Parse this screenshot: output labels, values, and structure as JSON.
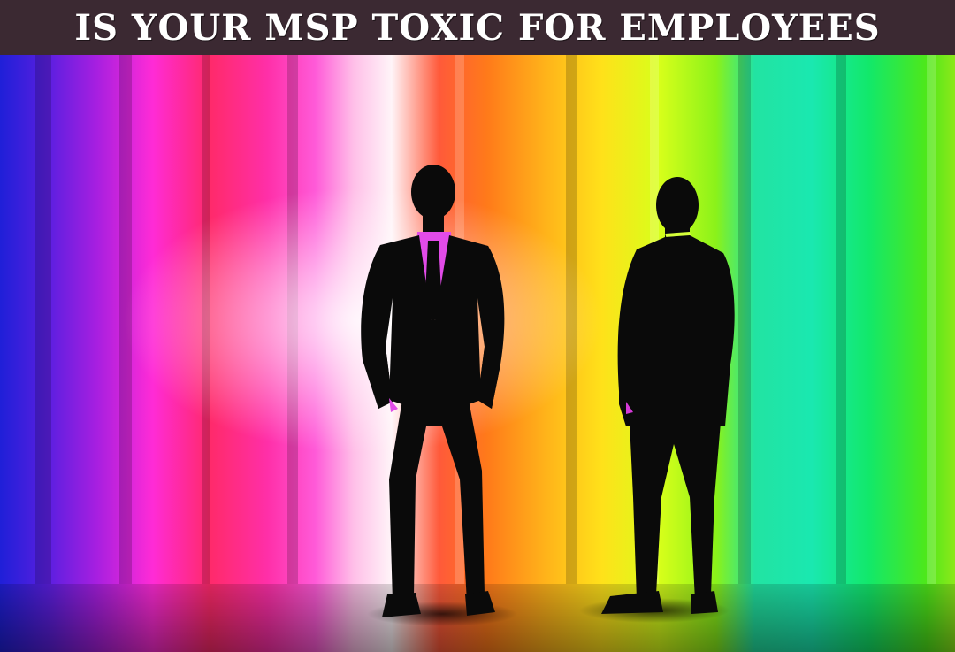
{
  "header": {
    "title": "IS YOUR MSP TOXIC FOR EMPLOYEES"
  },
  "scene": {
    "background": "rainbow-vertical-stripes",
    "colors": [
      "#1f1fd8",
      "#8a1fe0",
      "#ff2bd6",
      "#ff2a6a",
      "#ff4ad8",
      "#ffe6f6",
      "#ff7a2a",
      "#ffc21a",
      "#fff21a",
      "#b6ff1a",
      "#22e3a2",
      "#12e86a",
      "#7ce81a"
    ],
    "figures": [
      "businessman-facing-viewer",
      "businessman-facing-away"
    ]
  }
}
